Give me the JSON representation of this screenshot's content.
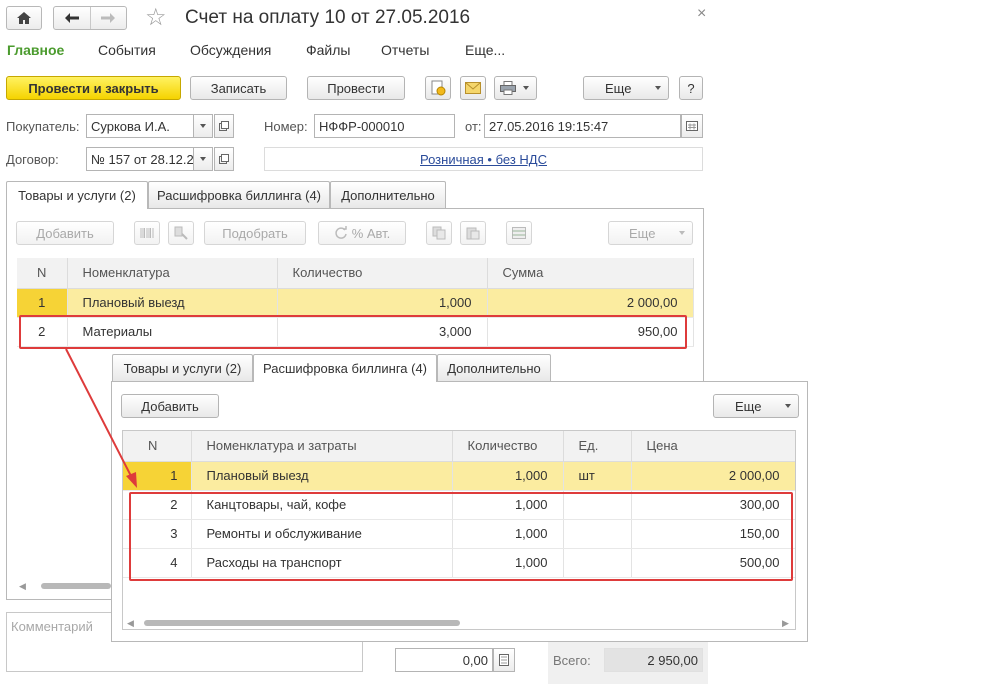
{
  "window": {
    "title": "Счет на оплату 10 от 27.05.2016",
    "star": "☆",
    "close": "×"
  },
  "nav_menu": [
    "Главное",
    "События",
    "Обсуждения",
    "Файлы",
    "Отчеты",
    "Еще..."
  ],
  "toolbar": {
    "post_close": "Провести и закрыть",
    "save": "Записать",
    "post": "Провести",
    "more": "Еще",
    "help": "?"
  },
  "form": {
    "buyer_label": "Покупатель:",
    "buyer_value": "Суркова И.А.",
    "number_label": "Номер:",
    "number_value": "НФФР-000010",
    "date_label": "от:",
    "date_value": "27.05.2016 19:15:47",
    "contract_label": "Договор:",
    "contract_value": "№ 157 от 28.12.2",
    "price_link": "Розничная • без НДС"
  },
  "main_tabs": [
    "Товары и услуги (2)",
    "Расшифровка биллинга (4)",
    "Дополнительно"
  ],
  "main_toolbar": {
    "add": "Добавить",
    "pick": "Подобрать",
    "auto": "% Авт.",
    "more": "Еще"
  },
  "main_table": {
    "columns": [
      "N",
      "Номенклатура",
      "Количество",
      "Сумма"
    ],
    "rows": [
      {
        "n": "1",
        "name": "Плановый выезд",
        "qty": "1,000",
        "sum": "2 000,00"
      },
      {
        "n": "2",
        "name": "Материалы",
        "qty": "3,000",
        "sum": "950,00"
      }
    ]
  },
  "overlay_tabs": [
    "Товары и услуги (2)",
    "Расшифровка биллинга (4)",
    "Дополнительно"
  ],
  "overlay_toolbar": {
    "add": "Добавить",
    "more": "Еще"
  },
  "overlay_table": {
    "columns": [
      "N",
      "Номенклатура и затраты",
      "Количество",
      "Ед.",
      "Цена"
    ],
    "rows": [
      {
        "n": "1",
        "name": "Плановый выезд",
        "qty": "1,000",
        "unit": "шт",
        "price": "2 000,00"
      },
      {
        "n": "2",
        "name": "Канцтовары, чай, кофе",
        "qty": "1,000",
        "unit": "",
        "price": "300,00"
      },
      {
        "n": "3",
        "name": "Ремонты и обслуживание",
        "qty": "1,000",
        "unit": "",
        "price": "150,00"
      },
      {
        "n": "4",
        "name": "Расходы на транспорт",
        "qty": "1,000",
        "unit": "",
        "price": "500,00"
      }
    ]
  },
  "footer": {
    "comment_placeholder": "Комментарий",
    "discount_value": "0,00",
    "total_label": "Всего:",
    "total_value": "2 950,00"
  },
  "colors": {
    "accent_green": "#4b9b2e",
    "primary_yellow": "#f5d300",
    "selected_row": "#fbeca0",
    "highlight_red": "#de3b3b"
  }
}
